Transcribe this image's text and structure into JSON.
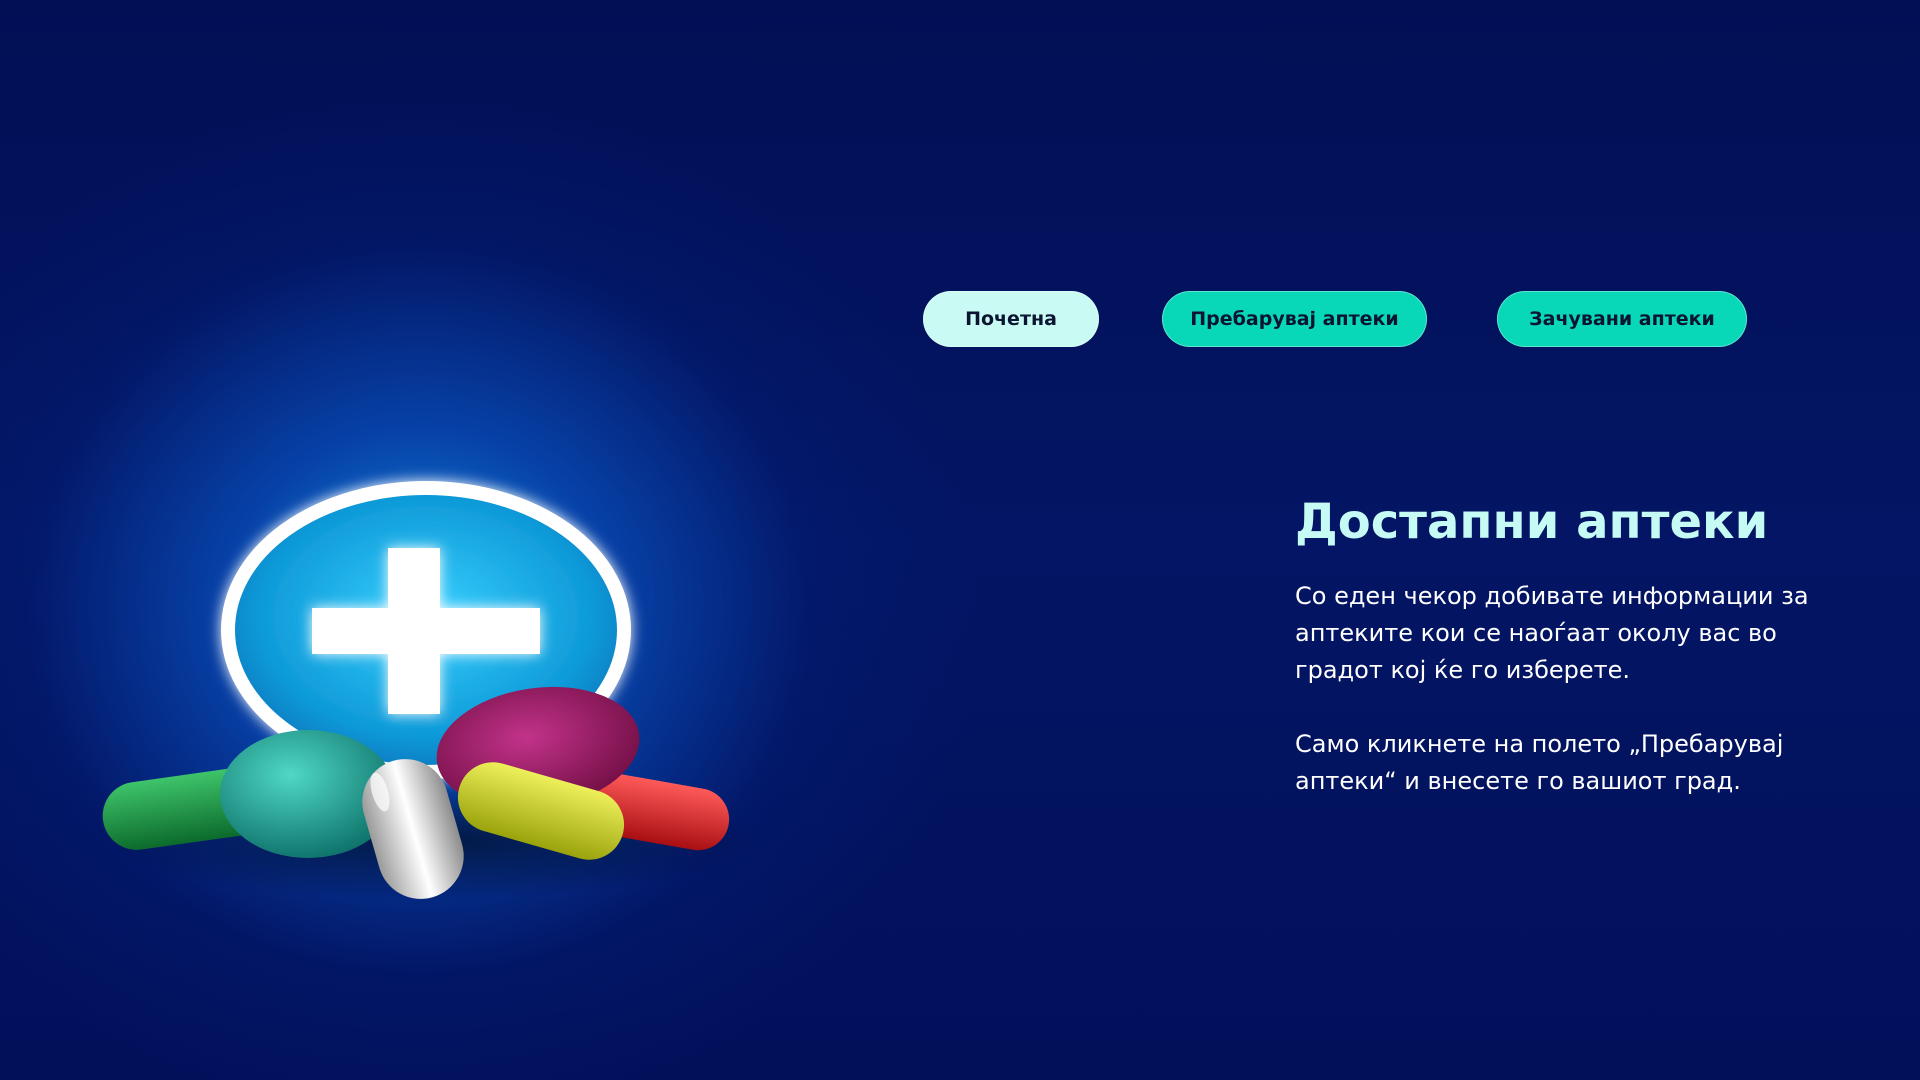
{
  "nav": {
    "home_label": "Почетна",
    "search_label": "Пребарувај аптеки",
    "saved_label": "Зачувани аптеки"
  },
  "hero": {
    "title": "Достапни аптеки",
    "paragraph_1": "Со еден чекор добивате информации за аптеките кои се наоѓаат околу вас во градот кој ќе го изберете.",
    "paragraph_2": "Само кликнете на полето „Пребарувај аптеки“ и внесете го вашиот град.",
    "illustration_icon": "medical-cross-pills-icon"
  },
  "colors": {
    "background": "#02105a",
    "glow": "#128ce6",
    "button_primary": "#08d8b8",
    "button_home": "#c9fbf4",
    "title": "#c5fbf4",
    "text": "#ffffff"
  }
}
